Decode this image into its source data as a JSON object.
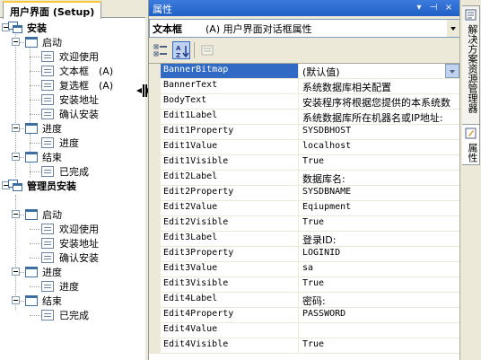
{
  "tree_panel": {
    "tab_label": "用户界面 (Setup)",
    "nodes": {
      "install": "安装",
      "startup": "启动",
      "welcome": "欢迎使用",
      "textbox": "文本框",
      "textbox_shortcut": "(A)",
      "checkbox": "复选框",
      "checkbox_shortcut": "(A)",
      "install_address": "安装地址",
      "confirm_install": "确认安装",
      "progress": "进度",
      "progress_item": "进度",
      "finish": "结束",
      "completed": "已完成",
      "admin_install": "管理员安装",
      "admin_startup": "启动",
      "admin_welcome": "欢迎使用",
      "admin_install_address": "安装地址",
      "admin_confirm_install": "确认安装",
      "admin_progress": "进度",
      "admin_progress_item": "进度",
      "admin_finish": "结束",
      "admin_completed": "已完成"
    }
  },
  "properties": {
    "title": "属性",
    "title_buttons": [
      "▾",
      "⊣",
      "×"
    ],
    "object_type": "文本框",
    "object_name": "(A) 用户界面对话框属性",
    "rows": [
      {
        "name": "BannerBitmap",
        "value": "(默认值)"
      },
      {
        "name": "BannerText",
        "value": "系统数据库相关配置"
      },
      {
        "name": "BodyText",
        "value": "安装程序将根据您提供的本系统数"
      },
      {
        "name": "Edit1Label",
        "value": "系统数据库所在机器名或IP地址:"
      },
      {
        "name": "Edit1Property",
        "value": "SYSDBHOST"
      },
      {
        "name": "Edit1Value",
        "value": "localhost"
      },
      {
        "name": "Edit1Visible",
        "value": "True"
      },
      {
        "name": "Edit2Label",
        "value": "数据库名:"
      },
      {
        "name": "Edit2Property",
        "value": "SYSDBNAME"
      },
      {
        "name": "Edit2Value",
        "value": "Eqiupment"
      },
      {
        "name": "Edit2Visible",
        "value": "True"
      },
      {
        "name": "Edit3Label",
        "value": "登录ID:"
      },
      {
        "name": "Edit3Property",
        "value": "LOGINID"
      },
      {
        "name": "Edit3Value",
        "value": "sa"
      },
      {
        "name": "Edit3Visible",
        "value": "True"
      },
      {
        "name": "Edit4Label",
        "value": "密码:"
      },
      {
        "name": "Edit4Property",
        "value": "PASSWORD"
      },
      {
        "name": "Edit4Value",
        "value": ""
      },
      {
        "name": "Edit4Visible",
        "value": "True"
      }
    ]
  },
  "side_tabs": {
    "solution_explorer": "解决方案资源管理器",
    "properties": "属性"
  },
  "colors": {
    "title_bar": "#1f5fc5",
    "selection": "#316ac5",
    "panel_bg": "#ece9d8"
  }
}
